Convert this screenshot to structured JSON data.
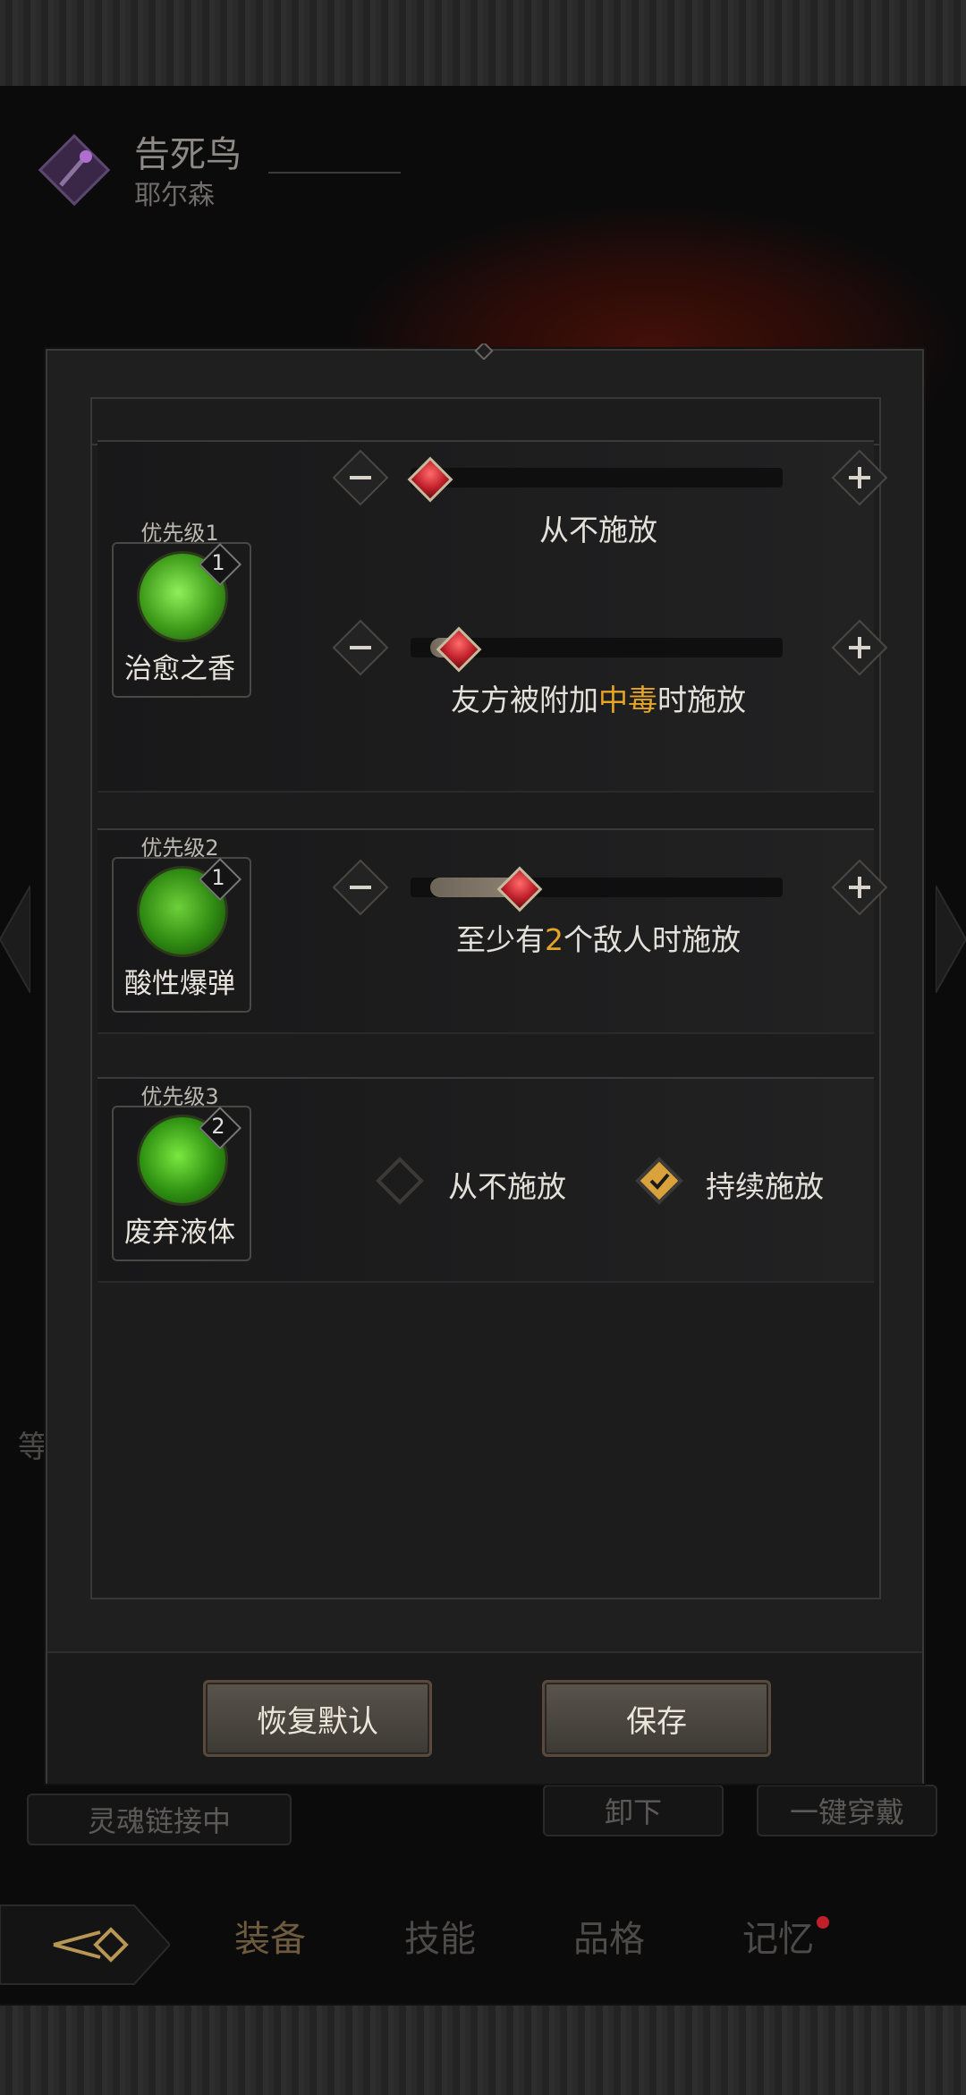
{
  "header": {
    "name": "告死鸟",
    "subtitle": "耶尔森"
  },
  "under": {
    "soul_link": "灵魂链接中",
    "unequip": "卸下",
    "equip_all": "一键穿戴",
    "level_char": "等"
  },
  "nav": {
    "tabs": [
      "装备",
      "技能",
      "品格",
      "记忆"
    ],
    "memory_badge_color": "#c0202a"
  },
  "skills": [
    {
      "priority": "优先级1",
      "name": "治愈之香",
      "level": "1",
      "sliders": [
        {
          "caption": "从不施放",
          "value_fraction": 0.0
        },
        {
          "caption_pre": "友方被附加",
          "caption_hl": "中毒",
          "caption_post": "时施放",
          "value_fraction": 0.08
        }
      ]
    },
    {
      "priority": "优先级2",
      "name": "酸性爆弹",
      "level": "1",
      "sliders": [
        {
          "caption_pre": "至少有",
          "caption_hl": "2",
          "caption_post": "个敌人时施放",
          "value_fraction": 0.25
        }
      ]
    },
    {
      "priority": "优先级3",
      "name": "废弃液体",
      "level": "2",
      "options": [
        {
          "label": "从不施放",
          "checked": false
        },
        {
          "label": "持续施放",
          "checked": true
        }
      ]
    }
  ],
  "actions": {
    "restore_default": "恢复默认",
    "save": "保存"
  },
  "colors": {
    "highlight": "#e5a526",
    "thumb": "#c0202a",
    "check_gold": "#d9a23a"
  }
}
